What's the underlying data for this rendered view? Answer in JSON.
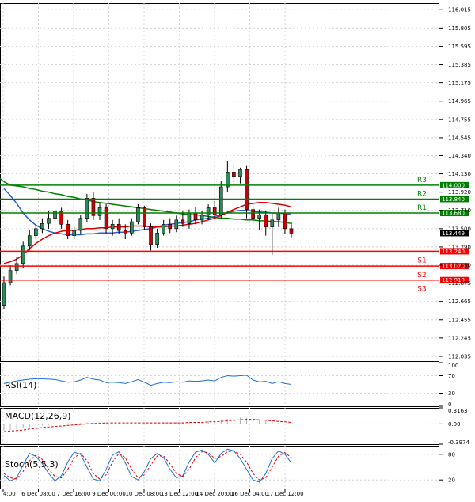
{
  "chart_data": [
    {
      "type": "candlestick",
      "panel": "price",
      "y_ticks": [
        "116.015",
        "115.805",
        "115.595",
        "115.385",
        "115.175",
        "114.965",
        "114.755",
        "114.545",
        "114.340",
        "114.130",
        "113.920",
        "113.710",
        "113.500",
        "113.290",
        "113.080",
        "112.875",
        "112.665",
        "112.455",
        "112.245",
        "112.035"
      ],
      "ylim": [
        111.98,
        116.09
      ],
      "x_ticks": [
        "4:00",
        "6 Dec 08:00",
        "7 Dec 16:00",
        "9 Dec 00:00",
        "10 Dec 08:00",
        "13 Dec 12:00",
        "14 Dec 20:00",
        "16 Dec 04:00",
        "17 Dec 12:00"
      ],
      "current_price": "113.449",
      "levels": [
        {
          "name": "R3",
          "price": 114.0,
          "label": "114.000",
          "color": "#008000"
        },
        {
          "name": "R2",
          "price": 113.84,
          "label": "113.840",
          "color": "#008000"
        },
        {
          "name": "R1",
          "price": 113.68,
          "label": "113.680",
          "color": "#008000"
        },
        {
          "name": "S1",
          "price": 113.24,
          "label": "113.240",
          "color": "#ff0000"
        },
        {
          "name": "S2",
          "price": 113.07,
          "label": "113.070",
          "color": "#ff0000"
        },
        {
          "name": "S3",
          "price": 112.91,
          "label": "112.910",
          "color": "#ff0000"
        }
      ],
      "ohlc": [
        [
          112.62,
          112.95,
          112.58,
          112.88
        ],
        [
          112.88,
          113.08,
          112.85,
          113.02
        ],
        [
          113.02,
          113.18,
          112.98,
          113.1
        ],
        [
          113.1,
          113.35,
          113.05,
          113.3
        ],
        [
          113.3,
          113.48,
          113.25,
          113.42
        ],
        [
          113.42,
          113.55,
          113.38,
          113.5
        ],
        [
          113.5,
          113.62,
          113.45,
          113.56
        ],
        [
          113.56,
          113.7,
          113.5,
          113.62
        ],
        [
          113.62,
          113.75,
          113.55,
          113.7
        ],
        [
          113.7,
          113.74,
          113.5,
          113.55
        ],
        [
          113.55,
          113.6,
          113.38,
          113.42
        ],
        [
          113.42,
          113.52,
          113.38,
          113.48
        ],
        [
          113.48,
          113.66,
          113.44,
          113.62
        ],
        [
          113.62,
          113.9,
          113.58,
          113.85
        ],
        [
          113.85,
          113.92,
          113.6,
          113.65
        ],
        [
          113.65,
          113.8,
          113.6,
          113.74
        ],
        [
          113.74,
          113.78,
          113.45,
          113.5
        ],
        [
          113.5,
          113.6,
          113.42,
          113.55
        ],
        [
          113.55,
          113.62,
          113.44,
          113.48
        ],
        [
          113.48,
          113.55,
          113.38,
          113.45
        ],
        [
          113.45,
          113.62,
          113.42,
          113.58
        ],
        [
          113.58,
          113.78,
          113.55,
          113.74
        ],
        [
          113.74,
          113.76,
          113.48,
          113.52
        ],
        [
          113.52,
          113.56,
          113.25,
          113.32
        ],
        [
          113.32,
          113.5,
          113.28,
          113.45
        ],
        [
          113.45,
          113.6,
          113.42,
          113.55
        ],
        [
          113.55,
          113.62,
          113.45,
          113.5
        ],
        [
          113.5,
          113.65,
          113.46,
          113.6
        ],
        [
          113.6,
          113.7,
          113.52,
          113.56
        ],
        [
          113.56,
          113.72,
          113.5,
          113.68
        ],
        [
          113.68,
          113.75,
          113.55,
          113.6
        ],
        [
          113.6,
          113.7,
          113.55,
          113.66
        ],
        [
          113.66,
          113.78,
          113.6,
          113.74
        ],
        [
          113.74,
          113.82,
          113.62,
          113.66
        ],
        [
          113.66,
          114.05,
          113.62,
          113.98
        ],
        [
          113.98,
          114.28,
          113.92,
          114.15
        ],
        [
          114.15,
          114.25,
          114.02,
          114.1
        ],
        [
          114.1,
          114.2,
          114.02,
          114.18
        ],
        [
          114.18,
          114.22,
          113.62,
          113.72
        ],
        [
          113.72,
          113.8,
          113.55,
          113.62
        ],
        [
          113.62,
          113.72,
          113.48,
          113.66
        ],
        [
          113.66,
          113.7,
          113.42,
          113.52
        ],
        [
          113.52,
          113.68,
          113.2,
          113.6
        ],
        [
          113.6,
          113.74,
          113.52,
          113.68
        ],
        [
          113.68,
          113.72,
          113.44,
          113.5
        ],
        [
          113.5,
          113.58,
          113.4,
          113.449
        ]
      ],
      "series": [
        {
          "name": "",
          "color": "#008000",
          "values": [
            114.04,
            114.0,
            113.99,
            113.98,
            113.96,
            113.95,
            113.93,
            113.92,
            113.9,
            113.89,
            113.87,
            113.86,
            113.84,
            113.83,
            113.81,
            113.8,
            113.79,
            113.78,
            113.77,
            113.76,
            113.75,
            113.74,
            113.73,
            113.72,
            113.71,
            113.7,
            113.69,
            113.68,
            113.67,
            113.66,
            113.66,
            113.65,
            113.64,
            113.63,
            113.62,
            113.62,
            113.61,
            113.61,
            113.6,
            113.6,
            113.59,
            113.59,
            113.58,
            113.58,
            113.57,
            113.56
          ]
        },
        {
          "name": "",
          "color": "#2a5bd7",
          "values": [
            113.96,
            113.88,
            113.79,
            113.68,
            113.6,
            113.54,
            113.5,
            113.47,
            113.45,
            113.44,
            113.43,
            113.43,
            113.43,
            113.44,
            113.44,
            113.45,
            113.45,
            113.45,
            113.46,
            113.46,
            113.47,
            113.48,
            113.49,
            113.5,
            113.52,
            113.54,
            113.55,
            113.56,
            113.57,
            113.58,
            113.6,
            113.61,
            113.62,
            113.64,
            113.66,
            113.68,
            113.7,
            113.71,
            113.71,
            113.7,
            113.69,
            113.69,
            113.68,
            113.68,
            113.67,
            113.67
          ]
        },
        {
          "name": "",
          "color": "#e00000",
          "values": [
            113.1,
            113.12,
            113.15,
            113.2,
            113.27,
            113.33,
            113.38,
            113.42,
            113.45,
            113.47,
            113.48,
            113.48,
            113.49,
            113.5,
            113.5,
            113.51,
            113.51,
            113.52,
            113.52,
            113.52,
            113.53,
            113.53,
            113.53,
            113.52,
            113.52,
            113.52,
            113.53,
            113.53,
            113.54,
            113.55,
            113.56,
            113.58,
            113.6,
            113.62,
            113.65,
            113.69,
            113.72,
            113.75,
            113.78,
            113.79,
            113.8,
            113.8,
            113.79,
            113.78,
            113.77,
            113.75
          ]
        }
      ]
    },
    {
      "type": "line",
      "panel": "rsi",
      "title": "RSI(14)",
      "y_ticks": [
        "100",
        "70",
        "30",
        "0"
      ],
      "ylim": [
        0,
        100
      ],
      "series": [
        {
          "name": "RSI(14)",
          "color": "#1e6fd6",
          "values": [
            52,
            55,
            58,
            60,
            62,
            63,
            63,
            62,
            61,
            58,
            55,
            56,
            60,
            66,
            62,
            60,
            54,
            55,
            54,
            52,
            56,
            61,
            55,
            48,
            52,
            55,
            54,
            56,
            55,
            58,
            57,
            58,
            60,
            58,
            66,
            70,
            69,
            70,
            71,
            60,
            56,
            57,
            52,
            56,
            52,
            50
          ]
        }
      ]
    },
    {
      "type": "line",
      "panel": "macd",
      "title": "MACD(12,26,9)",
      "y_ticks": [
        "0.3163",
        "0.00",
        "-0.3974"
      ],
      "ylim": [
        -0.3974,
        0.3163
      ],
      "series": [
        {
          "name": "",
          "type": "bar",
          "color": "#b0b0b0",
          "values": [
            -0.13,
            -0.12,
            -0.1,
            -0.08,
            -0.06,
            -0.05,
            -0.03,
            -0.02,
            -0.01,
            0.0,
            0.01,
            0.01,
            0.02,
            0.03,
            0.03,
            0.03,
            0.03,
            0.03,
            0.03,
            0.02,
            0.02,
            0.03,
            0.03,
            0.02,
            0.02,
            0.02,
            0.02,
            0.03,
            0.03,
            0.03,
            0.04,
            0.04,
            0.05,
            0.05,
            0.07,
            0.1,
            0.11,
            0.12,
            0.12,
            0.1,
            0.07,
            0.05,
            0.03,
            0.02,
            0.0,
            -0.01
          ]
        },
        {
          "name": "",
          "color": "#e00000",
          "values": [
            -0.15,
            -0.14,
            -0.13,
            -0.12,
            -0.1,
            -0.09,
            -0.07,
            -0.06,
            -0.05,
            -0.04,
            -0.03,
            -0.02,
            -0.01,
            0.0,
            0.01,
            0.01,
            0.02,
            0.02,
            0.02,
            0.02,
            0.02,
            0.02,
            0.02,
            0.02,
            0.02,
            0.02,
            0.02,
            0.02,
            0.02,
            0.03,
            0.03,
            0.03,
            0.04,
            0.04,
            0.05,
            0.06,
            0.07,
            0.08,
            0.09,
            0.09,
            0.08,
            0.07,
            0.06,
            0.05,
            0.04,
            0.03
          ]
        }
      ]
    },
    {
      "type": "line",
      "panel": "stochastic",
      "title": "Stoch(5,5,3)",
      "y_ticks": [
        "80",
        "20"
      ],
      "ylim": [
        0,
        100
      ],
      "series": [
        {
          "name": "",
          "color": "#1e6fd6",
          "values": [
            30,
            18,
            25,
            55,
            82,
            75,
            58,
            35,
            18,
            30,
            62,
            85,
            80,
            50,
            22,
            18,
            45,
            78,
            86,
            60,
            28,
            20,
            40,
            70,
            82,
            72,
            45,
            25,
            30,
            62,
            85,
            90,
            80,
            60,
            82,
            92,
            88,
            70,
            45,
            20,
            15,
            35,
            70,
            88,
            80,
            60
          ]
        },
        {
          "name": "",
          "color": "#e00000",
          "values": [
            35,
            25,
            22,
            40,
            65,
            78,
            68,
            45,
            28,
            25,
            45,
            72,
            82,
            65,
            35,
            22,
            32,
            62,
            82,
            72,
            45,
            25,
            32,
            55,
            76,
            76,
            58,
            35,
            28,
            45,
            72,
            86,
            84,
            70,
            75,
            86,
            88,
            80,
            62,
            35,
            20,
            25,
            50,
            76,
            84,
            72
          ]
        }
      ]
    }
  ]
}
